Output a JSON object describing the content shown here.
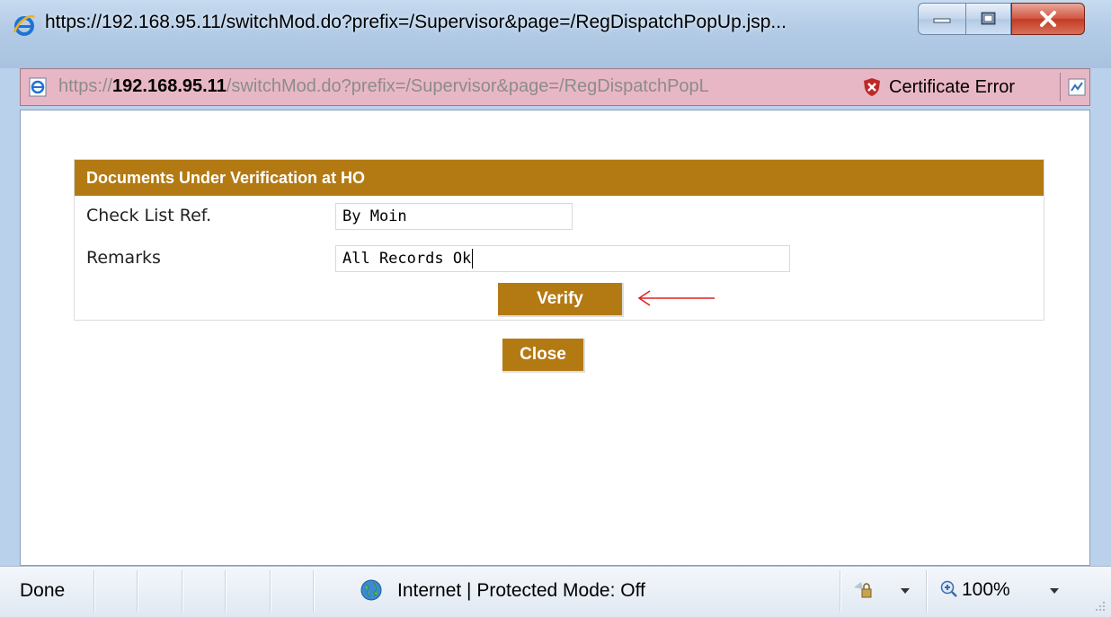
{
  "window": {
    "title": "https://192.168.95.11/switchMod.do?prefix=/Supervisor&page=/RegDispatchPopUp.jsp...",
    "controls": [
      "minimize",
      "maximize",
      "close"
    ]
  },
  "address_bar": {
    "url_prefix": "https://",
    "url_host": "192.168.95.11",
    "url_path": "/switchMod.do?prefix=/Supervisor&page=/RegDispatchPopL",
    "certificate_label": "Certificate Error"
  },
  "panel": {
    "header": "Documents Under Verification at HO",
    "fields": [
      {
        "label": "Check List Ref.",
        "value": "By Moin"
      },
      {
        "label": "Remarks",
        "value": "All Records Ok"
      }
    ],
    "verify_label": "Verify"
  },
  "close_label": "Close",
  "status_bar": {
    "status": "Done",
    "zone": "Internet | Protected Mode: Off",
    "zoom": "100%"
  },
  "colors": {
    "accent": "#b37a14",
    "address_bar_error": "#e8b7c6",
    "annotation_arrow": "#e02020"
  }
}
